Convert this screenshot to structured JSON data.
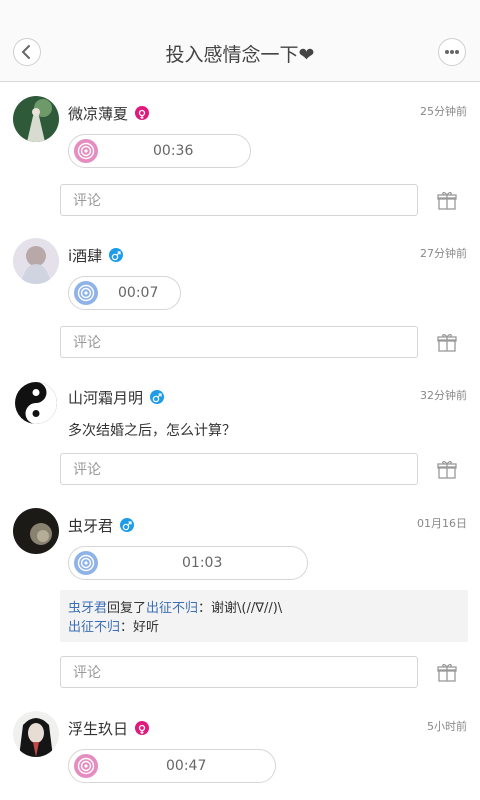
{
  "header": {
    "title": "投入感情念一下❤"
  },
  "posts": [
    {
      "username": "微凉薄夏",
      "gender": "female",
      "time": "25分钟前",
      "voice_duration": "00:36",
      "comment_placeholder": "评论"
    },
    {
      "username": "i酒肆",
      "gender": "male",
      "time": "27分钟前",
      "voice_duration": "00:07",
      "comment_placeholder": "评论"
    },
    {
      "username": "山河霜月明",
      "gender": "male",
      "time": "32分钟前",
      "text": "多次结婚之后，怎么计算？",
      "comment_placeholder": "评论"
    },
    {
      "username": "虫牙君",
      "gender": "male",
      "time": "01月16日",
      "voice_duration": "01:03",
      "replies": [
        {
          "from": "虫牙君",
          "verb": "回复了",
          "to": "出征不归",
          "text": "：谢谢\\(//∇//)\\"
        },
        {
          "from": "出征不归",
          "text": "：好听"
        }
      ],
      "comment_placeholder": "评论"
    },
    {
      "username": "浮生玖日",
      "gender": "female",
      "time": "5小时前",
      "voice_duration": "00:47"
    }
  ],
  "colors": {
    "female": "#e0197d",
    "male": "#1e9ce8",
    "voice_female": "#e58cc0",
    "voice_male": "#8fb3e8",
    "link": "#3d6fb5"
  }
}
